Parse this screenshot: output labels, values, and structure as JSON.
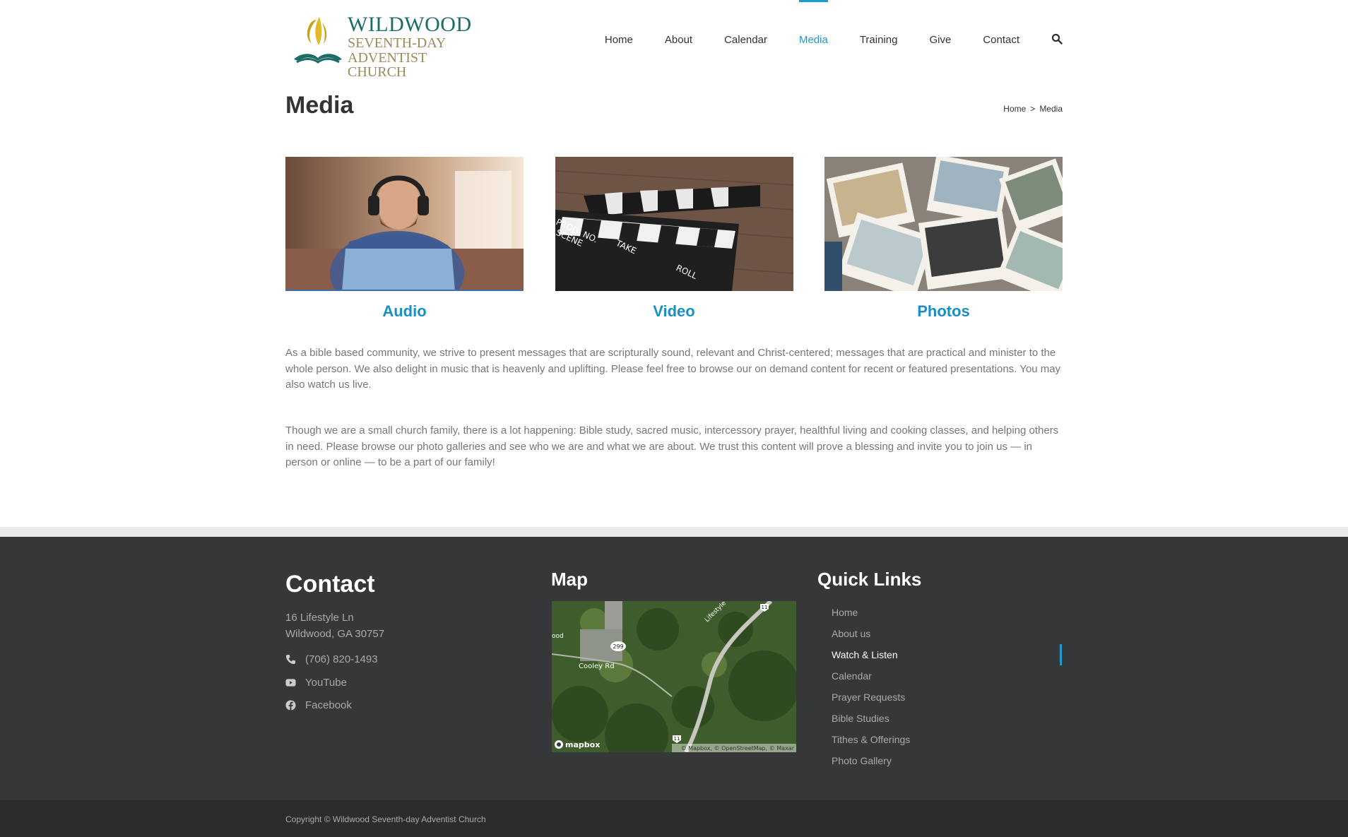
{
  "colors": {
    "accent": "#1a9cce",
    "footer_bg": "#363739",
    "copyright_bg": "#2b2c2e",
    "logo_green": "#1d6d67",
    "logo_gold": "#9b8a5a"
  },
  "header": {
    "logo": {
      "line1": "WILDWOOD",
      "line2": "SEVENTH-DAY",
      "line3": "ADVENTIST CHURCH"
    },
    "nav": [
      "Home",
      "About",
      "Calendar",
      "Media",
      "Training",
      "Give",
      "Contact"
    ],
    "active_nav": "Media",
    "search_icon": "search-icon"
  },
  "page": {
    "title": "Media",
    "breadcrumb": {
      "home": "Home",
      "separator": ">",
      "current": "Media"
    }
  },
  "tiles": [
    {
      "title": "Audio"
    },
    {
      "title": "Video"
    },
    {
      "title": "Photos"
    }
  ],
  "content": {
    "p1_line1": "As a bible based community, we strive to present messages that are scripturally sound, relevant and Christ-centered; messages that are practical and minister to the whole person. We also delight in music that is heavenly and uplifting. Please feel free to browse our on demand content for recent or featured presentations. You may",
    "p1_line2": "also watch us live.",
    "p2": "Though we are a small church family, there is a lot happening: Bible study, sacred music, intercessory prayer, healthful living and cooking classes, and helping others in need. Please browse our photo galleries and see who we are and what we are about. We trust this content will prove a blessing and invite you to join us — in person or online — to be a part of our family!"
  },
  "footer": {
    "contact": {
      "heading": "Contact",
      "address_line1": "16 Lifestyle Ln",
      "address_line2": "Wildwood, GA 30757",
      "phone": "(706) 820-1493",
      "youtube": "YouTube",
      "facebook": "Facebook"
    },
    "map": {
      "heading": "Map",
      "labels": {
        "road1": "Cooley Rd",
        "road2": "Lifestyle",
        "marker1": "299",
        "marker2": "11",
        "marker3": "11",
        "edge": "ood",
        "brand": "mapbox",
        "attribution": "© Mapbox, © OpenStreetMap, © Maxar"
      }
    },
    "quick_links": {
      "heading": "Quick Links",
      "items": [
        "Home",
        "About us",
        "Watch & Listen",
        "Calendar",
        "Prayer Requests",
        "Bible Studies",
        "Tithes & Offerings",
        "Photo Gallery"
      ],
      "active": "Watch & Listen"
    },
    "copyright": "Copyright © Wildwood Seventh-day Adventist Church"
  }
}
